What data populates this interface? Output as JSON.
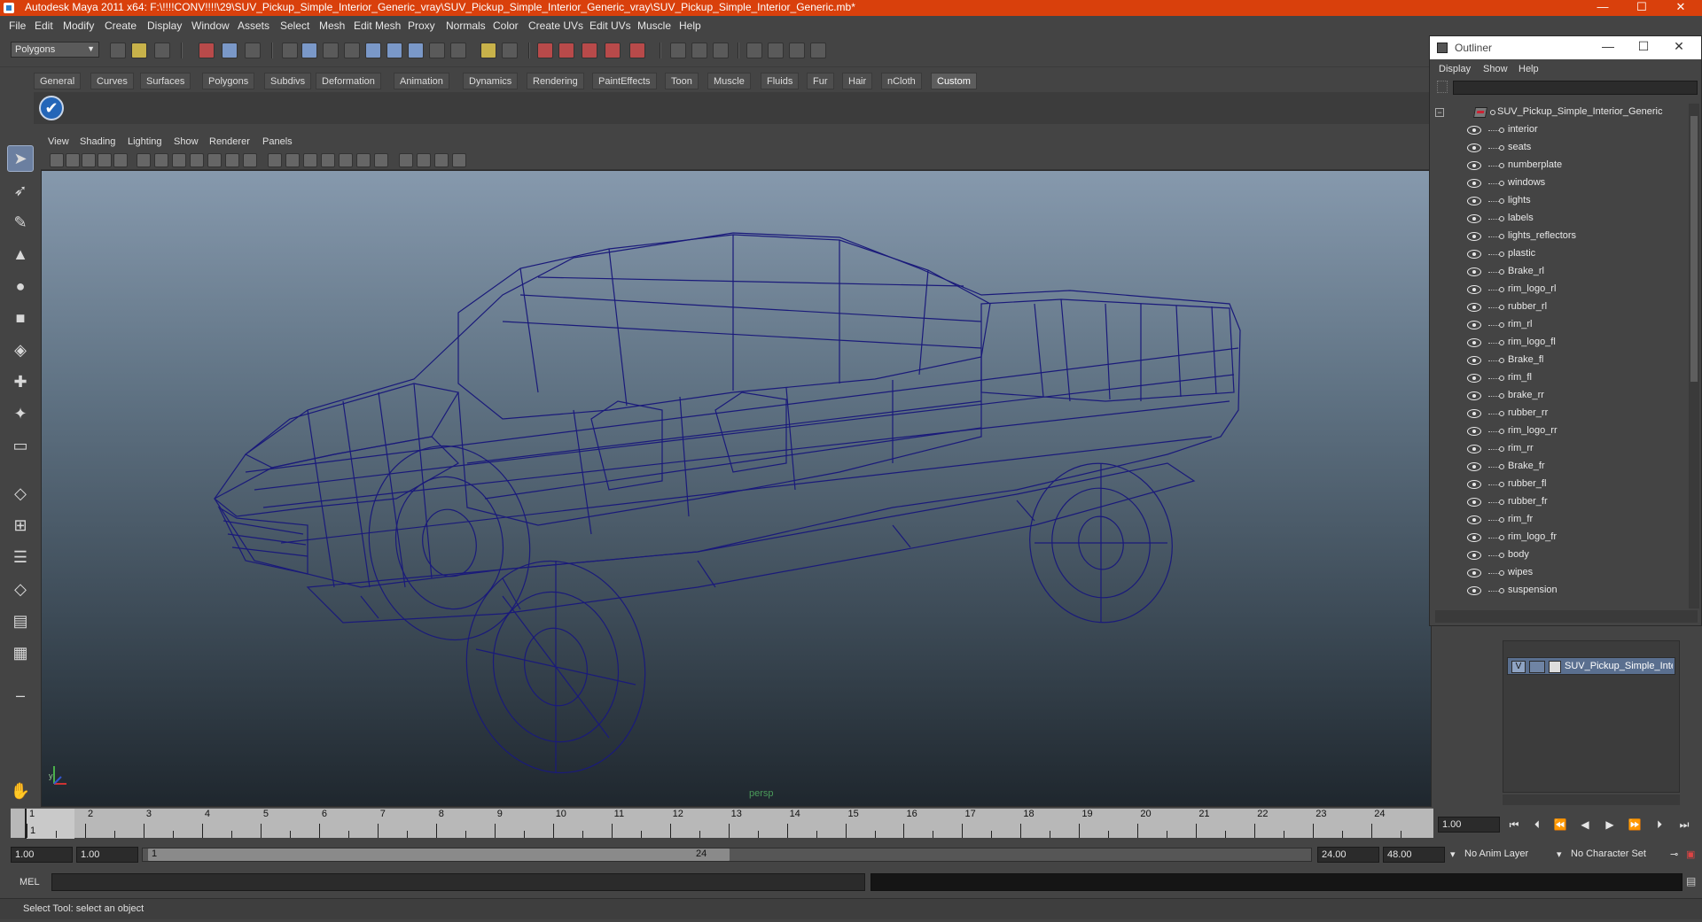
{
  "window": {
    "title": "Autodesk Maya 2011 x64: F:\\!!!!CONV!!!!\\29\\SUV_Pickup_Simple_Interior_Generic_vray\\SUV_Pickup_Simple_Interior_Generic_vray\\SUV_Pickup_Simple_Interior_Generic.mb*",
    "minimize": "—",
    "maximize": "☐",
    "close": "✕"
  },
  "menu": [
    "File",
    "Edit",
    "Modify",
    "Create",
    "Display",
    "Window",
    "Assets",
    "Select",
    "Mesh",
    "Edit Mesh",
    "Proxy",
    "Normals",
    "Color",
    "Create UVs",
    "Edit UVs",
    "Muscle",
    "Help"
  ],
  "statusline": {
    "mode": "Polygons"
  },
  "shelf": {
    "tabs": [
      "General",
      "Curves",
      "Surfaces",
      "Polygons",
      "Subdivs",
      "Deformation",
      "Animation",
      "Dynamics",
      "Rendering",
      "PaintEffects",
      "Toon",
      "Muscle",
      "Fluids",
      "Fur",
      "Hair",
      "nCloth",
      "Custom"
    ],
    "active_tab": "Custom"
  },
  "panel": {
    "menu": [
      "View",
      "Shading",
      "Lighting",
      "Show",
      "Renderer",
      "Panels"
    ],
    "camera_label": "persp",
    "axis_x": "x",
    "axis_y": "y",
    "wire_color": "#1a1a7a"
  },
  "timeline": {
    "ticks": [
      "1",
      "2",
      "3",
      "4",
      "5",
      "6",
      "7",
      "8",
      "9",
      "10",
      "11",
      "12",
      "13",
      "14",
      "15",
      "16",
      "17",
      "18",
      "19",
      "20",
      "21",
      "22",
      "23",
      "24"
    ],
    "current_frame": "1",
    "current_time_field": "1.00"
  },
  "range": {
    "start": "1.00",
    "start_playback": "1.00",
    "slider_start": "1",
    "slider_end": "24",
    "end_playback": "24.00",
    "end": "48.00",
    "anim_layer": "No Anim Layer",
    "character_set": "No Character Set"
  },
  "command": {
    "label": "MEL"
  },
  "help_line": "Select Tool: select an object",
  "outliner": {
    "title": "Outliner",
    "menu": [
      "Display",
      "Show",
      "Help"
    ],
    "root": "SUV_Pickup_Simple_Interior_Generic",
    "items": [
      "interior",
      "seats",
      "numberplate",
      "windows",
      "lights",
      "labels",
      "lights_reflectors",
      "plastic",
      "Brake_rl",
      "rim_logo_rl",
      "rubber_rl",
      "rim_rl",
      "rim_logo_fl",
      "Brake_fl",
      "rim_fl",
      "brake_rr",
      "rubber_rr",
      "rim_logo_rr",
      "rim_rr",
      "Brake_fr",
      "rubber_fl",
      "rubber_fr",
      "rim_fr",
      "rim_logo_fr",
      "body",
      "wipes",
      "suspension"
    ]
  },
  "layers": {
    "visible_flag": "V",
    "layer_name": "SUV_Pickup_Simple_Interior_Generic"
  }
}
